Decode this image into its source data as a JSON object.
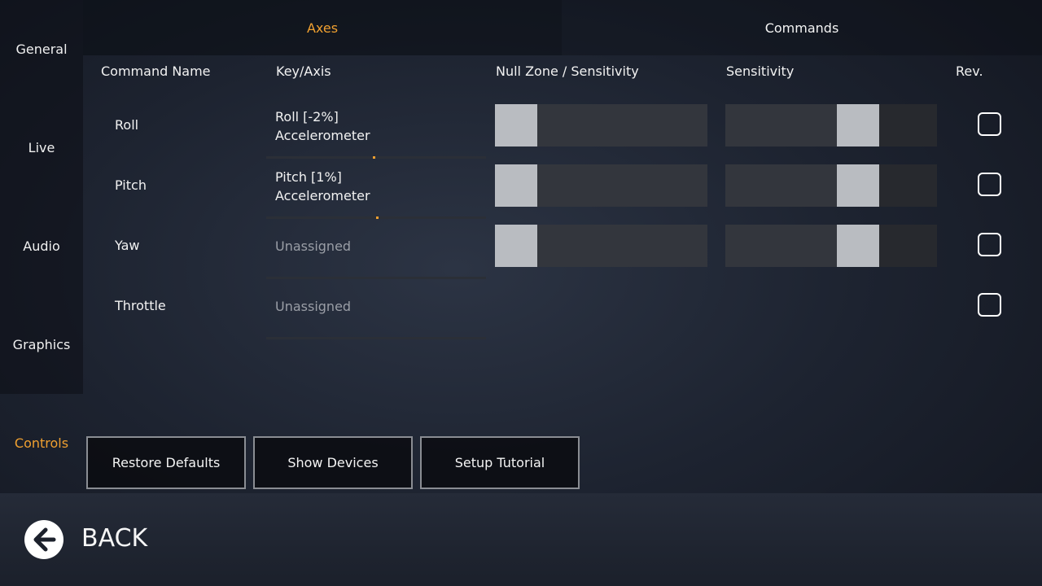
{
  "sidebar": {
    "items": [
      {
        "label": "General",
        "active": false
      },
      {
        "label": "Live",
        "active": false
      },
      {
        "label": "Audio",
        "active": false
      },
      {
        "label": "Graphics",
        "active": false
      },
      {
        "label": "Controls",
        "active": true
      }
    ]
  },
  "tabs": [
    {
      "label": "Axes",
      "active": true
    },
    {
      "label": "Commands",
      "active": false
    }
  ],
  "columns": {
    "command_name": "Command Name",
    "key_axis": "Key/Axis",
    "null_zone": "Null Zone / Sensitivity",
    "sensitivity": "Sensitivity",
    "reverse": "Rev."
  },
  "rows": [
    {
      "name": "Roll",
      "key_line1": "Roll [-2%]",
      "key_line2": "Accelerometer",
      "assigned": true,
      "null_zone": 0.0,
      "sensitivity": 0.66,
      "axis_indicator": 0.49,
      "reversed": false
    },
    {
      "name": "Pitch",
      "key_line1": "Pitch [1%]",
      "key_line2": "Accelerometer",
      "assigned": true,
      "null_zone": 0.0,
      "sensitivity": 0.66,
      "axis_indicator": 0.505,
      "reversed": false
    },
    {
      "name": "Yaw",
      "key_line1": "Unassigned",
      "key_line2": "",
      "assigned": false,
      "null_zone": 0.0,
      "sensitivity": 0.66,
      "reversed": false
    },
    {
      "name": "Throttle",
      "key_line1": "Unassigned",
      "key_line2": "",
      "assigned": false,
      "reversed": false
    }
  ],
  "buttons": {
    "restore": "Restore Defaults",
    "devices": "Show Devices",
    "tutorial": "Setup Tutorial"
  },
  "footer": {
    "back_label": "BACK",
    "back_icon": "arrow-left-circle-icon"
  },
  "colors": {
    "accent": "#f0a030",
    "handle": "#b9bcc1",
    "track_light": "#33363d",
    "track_dark": "#27292e"
  }
}
